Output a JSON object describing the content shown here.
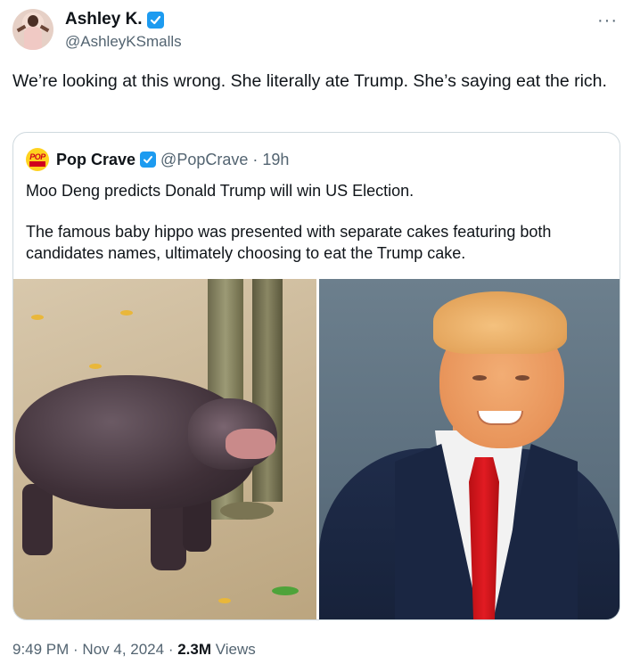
{
  "author": {
    "name": "Ashley K.",
    "handle": "@AshleyKSmalls",
    "avatar_icon": "avatar-photo"
  },
  "more_label": "···",
  "tweet": {
    "text": "We’re looking at this wrong. She literally ate Trump. She’s saying eat the rich."
  },
  "quote": {
    "name": "Pop Crave",
    "handle": "@PopCrave",
    "time": "· 19h",
    "avatar_text": "POP",
    "paragraph_1": "Moo Deng predicts Donald Trump will win US Election.",
    "paragraph_2": "The famous baby hippo was presented with separate cakes featuring both candidates names, ultimately choosing to eat the Trump cake.",
    "media": [
      {
        "icon": "hippo-photo"
      },
      {
        "icon": "trump-photo"
      }
    ]
  },
  "meta": {
    "timestamp": "9:49 PM · Nov 4, 2024 ·",
    "views_count": "2.3M",
    "views_label": "Views"
  },
  "colors": {
    "verified": "#1d9bf0",
    "text": "#0f1419",
    "secondary": "#536471",
    "border": "#cfd9de"
  }
}
